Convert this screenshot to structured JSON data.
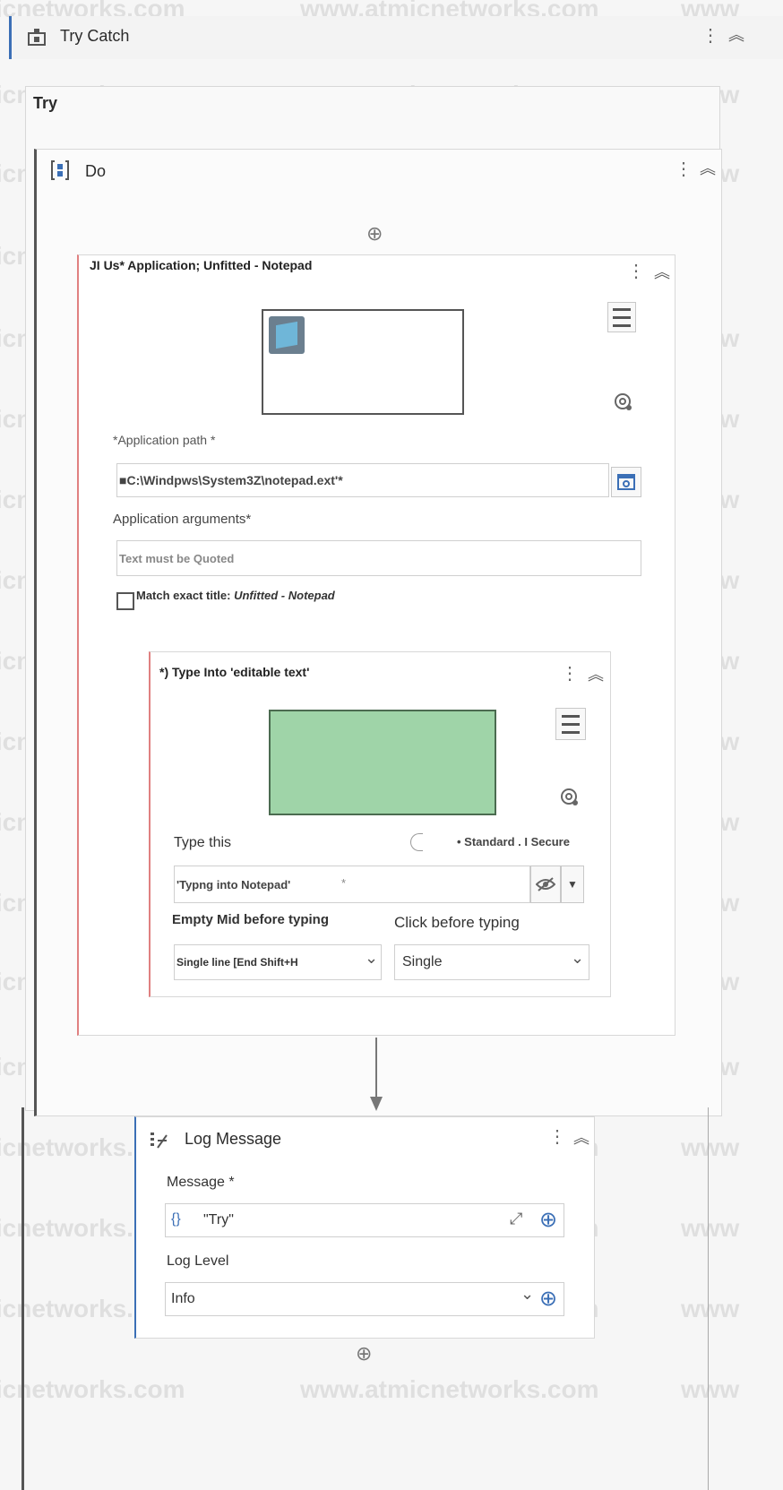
{
  "watermark": "www.atmicnetworks.com",
  "try_catch": {
    "title": "Try Catch",
    "kebab": "⋮",
    "collapse": "︽"
  },
  "try_section": {
    "title": "Try"
  },
  "do_seq": {
    "title": "Do",
    "kebab": "⋮",
    "collapse": "︽"
  },
  "use_app": {
    "title": "JI Us* Application; Unfitted - Notepad",
    "kebab": "⋮",
    "collapse": "︽",
    "app_path_label": "*Application path *",
    "app_path_value": "■C:\\Windpws\\System3Z\\notepad.ext'*",
    "app_args_label": "Application arguments*",
    "app_args_placeholder": "Text must be Quoted",
    "match_title_prefix": "Match exact title: ",
    "match_title_value": "Unfitted - Notepad"
  },
  "type_into": {
    "title": "*) Type Into 'editable text'",
    "kebab": "⋮",
    "collapse": "︽",
    "type_this_label": "Type this",
    "mode_text": "• Standard . I Secure",
    "type_value": "'Typng into Notepad'",
    "type_value_suffix": "*",
    "empty_field_label": "Empty Mid before typing",
    "empty_field_value": "Single line [End Shift+H",
    "click_before_label": "Click before typing",
    "click_before_value": "Single"
  },
  "log_message": {
    "title": "Log Message",
    "kebab": "⋮",
    "collapse": "︽",
    "message_label": "Message *",
    "message_brace": "{}",
    "message_value": "\"Try\"",
    "log_level_label": "Log Level",
    "log_level_value": "Info"
  },
  "icons": {
    "add": "⊕",
    "dropdown": "⌄",
    "expand": "⤢"
  }
}
